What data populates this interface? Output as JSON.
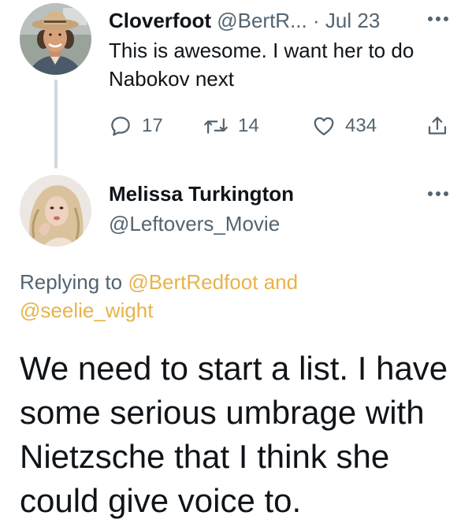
{
  "parent_tweet": {
    "display_name": "Cloverfoot",
    "handle": "@BertR...",
    "separator": "·",
    "date": "Jul 23",
    "text_line1": "This is awesome. I want her to do",
    "text_line2": "Nabokov next",
    "avatar_icon": "user-avatar-cowboy-hat",
    "actions": {
      "reply_count": "17",
      "retweet_count": "14",
      "like_count": "434"
    }
  },
  "reply_tweet": {
    "display_name": "Melissa Turkington",
    "handle": "@Leftovers_Movie",
    "avatar_icon": "user-avatar-woman",
    "replying_prefix": "Replying to",
    "mention_1": "@BertRedfoot",
    "mention_joiner": "and",
    "mention_2": "@seelie_wight",
    "text_line1": "We need to start a list. I have",
    "text_line2": "some serious umbrage with",
    "text_line3": "Nietzsche that I think she",
    "text_line4": "could give voice to."
  },
  "colors": {
    "text_primary": "#0f1419",
    "text_muted": "#536471",
    "mention": "#e8b34a",
    "thread_line": "#cfd9de"
  },
  "icons": [
    "reply-icon",
    "retweet-icon",
    "like-icon",
    "share-icon",
    "more-options-icon"
  ]
}
